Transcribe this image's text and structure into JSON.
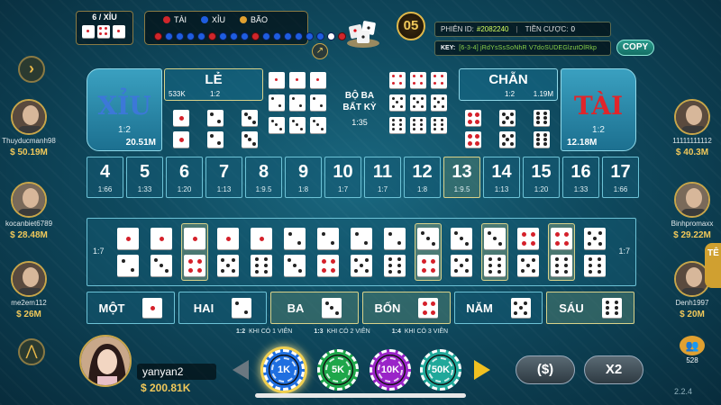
{
  "last_roll": {
    "title": "6 / XỈU",
    "dice": [
      1,
      4,
      1
    ]
  },
  "history": {
    "legend": [
      {
        "label": "TÀI",
        "color": "#d0262b"
      },
      {
        "label": "XỈU",
        "color": "#1e5de0"
      },
      {
        "label": "BÃO",
        "color": "#e0a030"
      }
    ],
    "results": [
      "r",
      "x",
      "x",
      "x",
      "x",
      "r",
      "x",
      "x",
      "x",
      "r",
      "x",
      "x",
      "x",
      "x",
      "x",
      "x",
      "w",
      "r"
    ]
  },
  "timer": "05",
  "session": {
    "id_label": "PHIÊN ID:",
    "id_value": "#2082240",
    "bet_label": "TIỀN CƯỢC:",
    "bet_value": "0"
  },
  "key": {
    "label": "KEY:",
    "value": "[6-3-4] jRdYsSsSoNhR V7doSUDEGlzutOlRkp"
  },
  "copy_label": "COPY",
  "players_left": [
    {
      "name": "Thuyducmanh98",
      "balance": "$ 50.19M"
    },
    {
      "name": "kocanbiet6789",
      "balance": "$ 28.48M"
    },
    {
      "name": "me2em112",
      "balance": "$ 26M"
    }
  ],
  "players_right": [
    {
      "name": "11111111112",
      "balance": "$ 40.3M"
    },
    {
      "name": "Binhpromaxx",
      "balance": "$ 29.22M"
    },
    {
      "name": "Denh1997",
      "balance": "$ 20M"
    }
  ],
  "online_count": "528",
  "tab_label": "TÊ",
  "board": {
    "xiu": {
      "label": "XỈU",
      "odds": "1:2",
      "amount": "20.51M"
    },
    "tai": {
      "label": "TÀI",
      "odds": "1:2",
      "amount": "12.18M"
    },
    "le": {
      "label": "LẺ",
      "amount": "533K",
      "odds": "1:2"
    },
    "chan": {
      "label": "CHẴN",
      "amount": "1.19M",
      "odds": "1:2"
    },
    "any_triple": {
      "label_1": "BỘ BA",
      "label_2": "BẤT KỲ",
      "odds": "1:35"
    },
    "triples_left": [
      [
        1,
        1,
        1
      ],
      [
        2,
        2,
        2
      ],
      [
        3,
        3,
        3
      ]
    ],
    "triples_right": [
      [
        4,
        4,
        4
      ],
      [
        5,
        5,
        5
      ],
      [
        6,
        6,
        6
      ]
    ],
    "doubles_left": [
      [
        1,
        1
      ],
      [
        2,
        2
      ],
      [
        3,
        3
      ]
    ],
    "doubles_right": [
      [
        4,
        4
      ],
      [
        5,
        5
      ],
      [
        6,
        6
      ]
    ],
    "totals": [
      {
        "n": "4",
        "o": "1:66"
      },
      {
        "n": "5",
        "o": "1:33"
      },
      {
        "n": "6",
        "o": "1:20"
      },
      {
        "n": "7",
        "o": "1:13"
      },
      {
        "n": "8",
        "o": "1:9.5"
      },
      {
        "n": "9",
        "o": "1:8"
      },
      {
        "n": "10",
        "o": "1:7"
      },
      {
        "n": "11",
        "o": "1:7"
      },
      {
        "n": "12",
        "o": "1:8"
      },
      {
        "n": "13",
        "o": "1:9.5"
      },
      {
        "n": "14",
        "o": "1:13"
      },
      {
        "n": "15",
        "o": "1:20"
      },
      {
        "n": "16",
        "o": "1:33"
      },
      {
        "n": "17",
        "o": "1:66"
      }
    ],
    "totals_highlight": "13",
    "combo_odds": "1:7",
    "combos": [
      [
        1,
        2
      ],
      [
        1,
        3
      ],
      [
        1,
        4
      ],
      [
        1,
        5
      ],
      [
        1,
        6
      ],
      [
        2,
        3
      ],
      [
        2,
        4
      ],
      [
        2,
        5
      ],
      [
        2,
        6
      ],
      [
        3,
        4
      ],
      [
        3,
        5
      ],
      [
        3,
        6
      ],
      [
        4,
        5
      ],
      [
        4,
        6
      ],
      [
        5,
        6
      ]
    ],
    "combos_highlight": [
      2,
      9,
      11,
      13
    ],
    "singles": [
      {
        "label": "MỘT",
        "face": 1
      },
      {
        "label": "HAI",
        "face": 2
      },
      {
        "label": "BA",
        "face": 3
      },
      {
        "label": "BỐN",
        "face": 4
      },
      {
        "label": "NĂM",
        "face": 5
      },
      {
        "label": "SÁU",
        "face": 6
      }
    ],
    "singles_highlight": [
      "BA",
      "BỐN",
      "SÁU"
    ],
    "payouts": [
      {
        "ratio": "1:2",
        "text": "KHI CÓ 1 VIÊN"
      },
      {
        "ratio": "1:3",
        "text": "KHI CÓ 2 VIÊN"
      },
      {
        "ratio": "1:4",
        "text": "KHI CÓ 3 VIÊN"
      }
    ]
  },
  "me": {
    "name": "yanyan2",
    "balance": "$ 200.81K"
  },
  "chips": [
    {
      "label": "1K",
      "color": "#1f6fe0",
      "selected": true
    },
    {
      "label": "5K",
      "color": "#1ea64a",
      "selected": false
    },
    {
      "label": "10K",
      "color": "#9a24c8",
      "selected": false
    },
    {
      "label": "50K",
      "color": "#20a89a",
      "selected": false
    }
  ],
  "rebet_label": "($)",
  "double_label": "X2",
  "version": "2.2.4"
}
